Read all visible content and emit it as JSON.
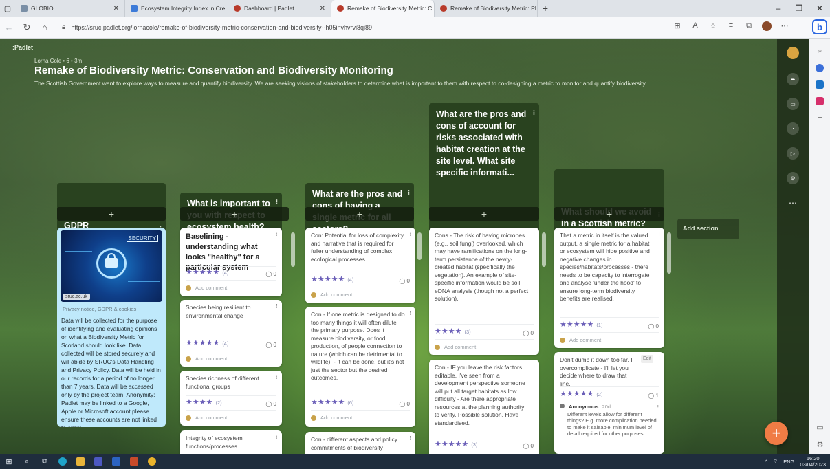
{
  "browser": {
    "tabs": [
      {
        "label": "GLOBIO",
        "active": false,
        "color": "#7a8fa6"
      },
      {
        "label": "Ecosystem Integrity Index in Cre",
        "active": false,
        "color": "#3d7bd8"
      },
      {
        "label": "Dashboard | Padlet",
        "active": false,
        "color": "#b83a2a"
      },
      {
        "label": "Remake of Biodiversity Metric: C",
        "active": true,
        "color": "#b83a2a"
      },
      {
        "label": "Remake of Biodiversity Metric: Pl",
        "active": false,
        "color": "#b83a2a"
      }
    ],
    "url": "https://sruc.padlet.org/lornacole/remake-of-biodiversity-metric-conservation-and-biodiversity--h05invhvrvi8qi89"
  },
  "padlet": {
    "brand": ":Padlet",
    "author": "Lorna Cole • 6 • 3m",
    "title": "Remake of Biodiversity Metric: Conservation and Biodiversity Monitoring",
    "description": "The Scottish Government want to explore ways to measure and quantify biodiversity. We are seeking visions of stakeholders to determine what is important to them with respect to co-designing a metric to monitor and quantify biodiversity.",
    "add_section": "Add section",
    "add_comment": "Add comment"
  },
  "columns": {
    "gdpr": {
      "title": "GDPR",
      "image_label": "SECURITY",
      "image_source": "sruc.ac.uk",
      "link": "Privacy notice, GDPR & cookies",
      "text": "Data will be collected for the purpose of identifying and evaluating opinions on what a Biodiversity Metric for Scotland should look like. Data collected will be stored securely and will abide by SRUC's Data Handling and Privacy Policy. Data will be held in our records for a period of no longer than 7 years. Data will be accessed only by the project team. Anonymity: Padlet may be linked to a Google, Apple or Microsoft account please ensure these accounts are not linked to allow"
    },
    "c1": {
      "title": "What is important to you with respect to ecosystem health?",
      "cards": [
        {
          "subject": "Baselining - understanding what looks \"healthy\" for a particular system",
          "stars": "★★★★★",
          "count": "(4)",
          "comments": "0"
        },
        {
          "body": "Species being resilient to environmental change",
          "stars": "★★★★★",
          "count": "(4)",
          "comments": "0"
        },
        {
          "body": "Species richness of different functional groups",
          "stars": "★★★★",
          "count": "(2)",
          "comments": "0"
        },
        {
          "body": "Integrity of ecosystem functions/processes"
        }
      ]
    },
    "c2": {
      "title": "What are the pros and cons of having a single metric for all sectors?",
      "cards": [
        {
          "body": "Con: Potential for loss of complexity and narrative that is required for fuller understanding of complex ecological processes",
          "stars": "★★★★★",
          "count": "(4)",
          "comments": "0"
        },
        {
          "body": "Con - If one metric is designed to do too many things it will often dilute the primary purpose. Does it measure biodiversity, or food production, of people connection to nature (which can be detrimental to wildlife). - It can be done, but it's not just the sector but the desired outcomes.",
          "stars": "★★★★★",
          "count": "(6)",
          "comments": "0"
        },
        {
          "body": "Con - different aspects and policy commitments of biodiversity"
        }
      ]
    },
    "c3": {
      "title": "What are the pros and cons of account for risks associated with habitat creation at the site level. What site specific informati...",
      "cards": [
        {
          "body": "Cons - The risk of having microbes (e.g., soil fungi) overlooked, which may have ramifications on the long-term persistence of the newly-created habitat (specifically the vegetation). An example of site-specific information would be soil eDNA analysis (though not a perfect solution).",
          "stars": "★★★★",
          "count": "(3)",
          "comments": "0"
        },
        {
          "body": "Con - IF you leave the risk factors editable, I've seen from a development perspective someone will put all target habitats as low difficulty - Are there appropriate resources at the planning authority to verify. Possible solution. Have standardised.",
          "stars": "★★★★★",
          "count": "(3)",
          "comments": "0"
        }
      ]
    },
    "c4": {
      "title": "What should we avoid in a Scottish metric?",
      "cards": [
        {
          "body": "That a metric in itself is the valued output, a single metric for a habitat or ecosystem will hide positive and negative changes in species/habitats/processes - there needs to be capacity to interrogate and analyse 'under the hood' to ensure long-term biodiversity benefits are realised.",
          "stars": "★★★★★",
          "count": "(1)",
          "comments": "0"
        },
        {
          "body": "Don't dumb it down too far, I overcomplicate - I'll let you decide where to draw that line.",
          "edit": "Edit",
          "stars": "★★★★★",
          "count": "(2)",
          "comments": "1",
          "reply_author": "Anonymous",
          "reply_time": "20d",
          "reply_text": "Different levels allow for different things? E.g. more complication needed to make it saleable, minimum level of detail required for other purposes"
        }
      ]
    }
  },
  "taskbar": {
    "lang": "ENG",
    "time": "16:20",
    "date": "03/04/2023"
  }
}
